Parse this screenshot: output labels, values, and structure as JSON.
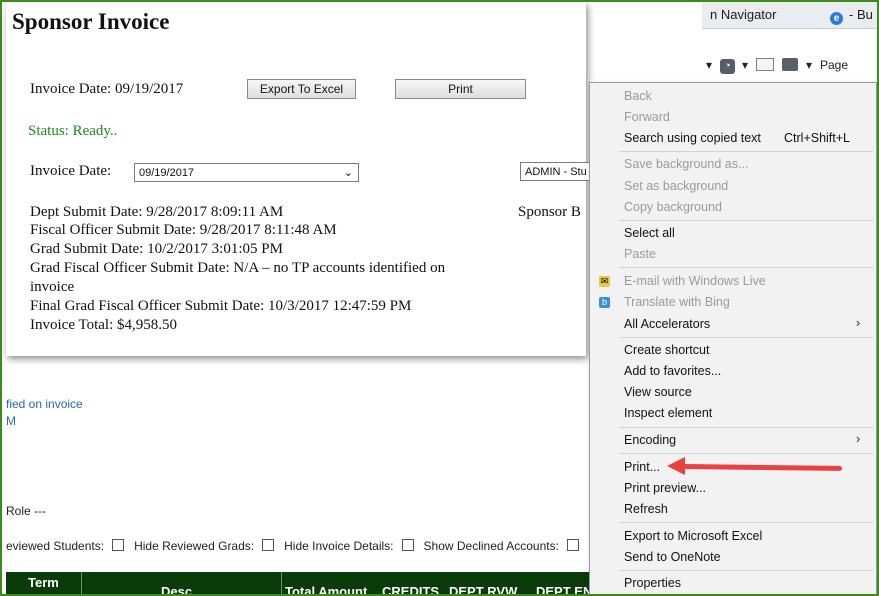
{
  "browser": {
    "tabs": [
      {
        "label": "n Navigator"
      },
      {
        "label": "- Bu"
      }
    ],
    "toolbar": {
      "page_label": "Page"
    }
  },
  "background_page": {
    "link_line1": "fied on invoice",
    "link_line2": "M",
    "role_text": "Role ---",
    "filters": {
      "reviewed_students": "eviewed Students:",
      "hide_reviewed_grads": "Hide Reviewed Grads:",
      "hide_invoice_details": "Hide Invoice Details:",
      "show_declined_accounts": "Show Declined Accounts:"
    },
    "grid_headers": [
      "Term",
      "Desc",
      "Total Amount",
      "CREDITS",
      "DEPT RVW",
      "DEPT EN"
    ]
  },
  "popup": {
    "title": "Sponsor Invoice",
    "invoice_date_text": "Invoice Date: 09/19/2017",
    "export_button": "Export To Excel",
    "print_button": "Print",
    "status": "Status: Ready..",
    "invoice_date_label": "Invoice Date:",
    "invoice_date_selected": "09/19/2017",
    "admin_select": "ADMIN - Stu",
    "sponsor_label": "Sponsor B",
    "details": {
      "dept_submit": "Dept Submit Date: 9/28/2017 8:09:11 AM",
      "fiscal_officer_submit": "Fiscal Officer Submit Date: 9/28/2017 8:11:48 AM",
      "grad_submit": "Grad Submit Date: 10/2/2017 3:01:05 PM",
      "grad_fiscal_line1": "Grad Fiscal Officer Submit Date: N/A – no TP accounts identified on",
      "grad_fiscal_line2": "invoice",
      "final_grad_fiscal": "Final Grad Fiscal Officer Submit Date: 10/3/2017 12:47:59 PM",
      "invoice_total": "Invoice Total: $4,958.50"
    }
  },
  "context_menu": {
    "back": "Back",
    "forward": "Forward",
    "search_copied": "Search using copied text",
    "search_shortcut": "Ctrl+Shift+L",
    "save_background": "Save background as...",
    "set_background": "Set as background",
    "copy_background": "Copy background",
    "select_all": "Select all",
    "paste": "Paste",
    "email_live": "E-mail with Windows Live",
    "translate_bing": "Translate with Bing",
    "all_accelerators": "All Accelerators",
    "create_shortcut": "Create shortcut",
    "add_favorites": "Add to favorites...",
    "view_source": "View source",
    "inspect_element": "Inspect element",
    "encoding": "Encoding",
    "print": "Print...",
    "print_preview": "Print preview...",
    "refresh": "Refresh",
    "export_excel": "Export to Microsoft Excel",
    "send_onenote": "Send to OneNote",
    "properties": "Properties"
  },
  "colors": {
    "frame_border": "#3d8a1c",
    "status_green": "#1b8a1b",
    "grid_header": "#0b3b0b",
    "annotation_arrow": "#e8413f"
  }
}
